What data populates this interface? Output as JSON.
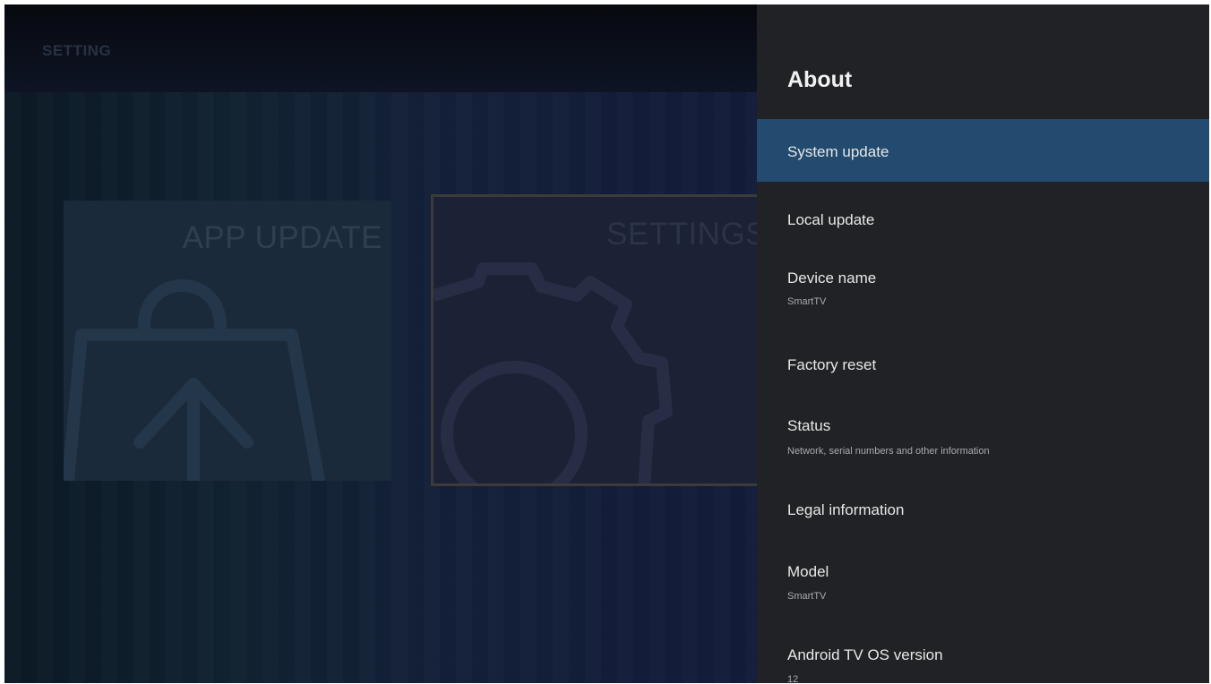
{
  "launcher": {
    "title": "SETTING",
    "tiles": [
      {
        "label": "APP UPDATE",
        "icon": "bag-upload-icon"
      },
      {
        "label": "SETTINGS",
        "icon": "gear-icon"
      }
    ]
  },
  "panel": {
    "title": "About",
    "items": [
      {
        "label": "System update",
        "sub": ""
      },
      {
        "label": "Local update",
        "sub": ""
      },
      {
        "label": "Device name",
        "sub": "SmartTV"
      },
      {
        "label": "Factory reset",
        "sub": ""
      },
      {
        "label": "Status",
        "sub": "Network, serial numbers and other information"
      },
      {
        "label": "Legal information",
        "sub": ""
      },
      {
        "label": "Model",
        "sub": "SmartTV"
      },
      {
        "label": "Android TV OS version",
        "sub": "12"
      }
    ]
  },
  "colors": {
    "focus": "#234a6f",
    "panel_bg": "#212226",
    "launcher_bg": "#112231"
  }
}
